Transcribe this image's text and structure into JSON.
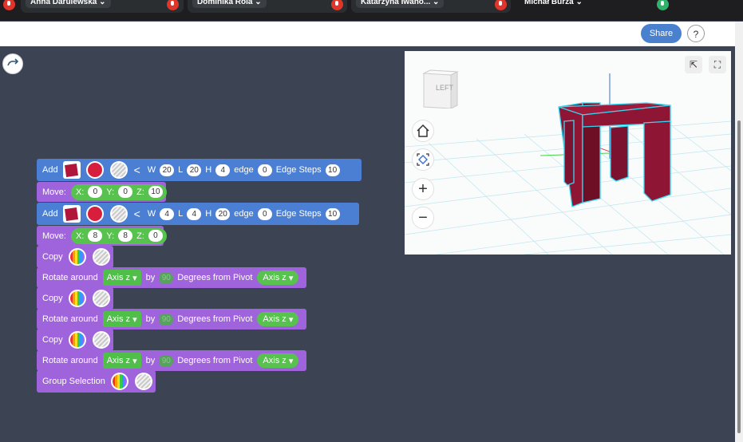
{
  "participants": [
    {
      "name": "Anna Darulewska",
      "mic": "muted"
    },
    {
      "name": "Dominika Rola",
      "mic": "muted"
    },
    {
      "name": "Katarzyna Iwańo...",
      "mic": "muted"
    },
    {
      "name": "Michał Burza",
      "mic": "on"
    }
  ],
  "header": {
    "share_label": "Share",
    "help_label": "?"
  },
  "blocks": {
    "add1": {
      "label": "Add",
      "w_label": "W",
      "w": "20",
      "l_label": "L",
      "l": "20",
      "h_label": "H",
      "h": "4",
      "edge_label": "edge",
      "edge": "0",
      "steps_label": "Edge Steps",
      "steps": "10"
    },
    "move1": {
      "label": "Move:",
      "x_label": "X:",
      "x": "0",
      "y_label": "Y:",
      "y": "0",
      "z_label": "Z:",
      "z": "10"
    },
    "add2": {
      "label": "Add",
      "w_label": "W",
      "w": "4",
      "l_label": "L",
      "l": "4",
      "h_label": "H",
      "h": "20",
      "edge_label": "edge",
      "edge": "0",
      "steps_label": "Edge Steps",
      "steps": "10"
    },
    "move2": {
      "label": "Move:",
      "x_label": "X:",
      "x": "8",
      "y_label": "Y:",
      "y": "8",
      "z_label": "Z:",
      "z": "0"
    },
    "copy_label": "Copy",
    "rotate": {
      "label": "Rotate around",
      "axis": "Axis z",
      "by_label": "by",
      "degrees": "90",
      "pivot_label": "Degrees from Pivot",
      "pivot_axis": "Axis z"
    },
    "group_label": "Group Selection"
  },
  "viewport": {
    "cube_label": "LEFT"
  },
  "icons": [
    "undo-icon",
    "home-icon",
    "fit-icon",
    "zoom-in-icon",
    "zoom-out-icon",
    "camera-icon",
    "fullscreen-icon",
    "mic-muted-icon",
    "mic-on-icon"
  ],
  "colors": {
    "add_block": "#4a7fd4",
    "transform_block": "#9f63dc",
    "value_green": "#58c24e",
    "model": "#8e1533",
    "workspace": "#3c4453"
  }
}
